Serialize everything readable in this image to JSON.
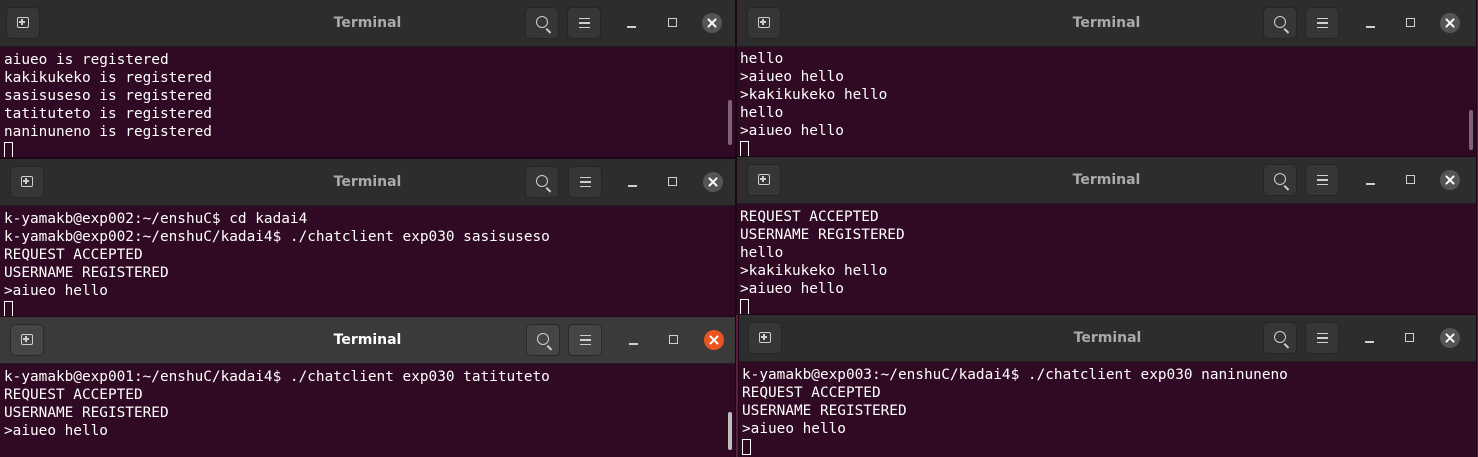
{
  "windows": [
    {
      "title": "Terminal",
      "active": false,
      "lines": [
        "aiueo is registered",
        "kakikukeko is registered",
        "sasisuseso is registered",
        "tatituteto is registered",
        "naninuneno is registered"
      ]
    },
    {
      "title": "Terminal",
      "active": false,
      "lines": [
        "hello",
        ">aiueo hello",
        ">kakikukeko hello",
        "hello",
        ">aiueo hello"
      ]
    },
    {
      "title": "Terminal",
      "active": false,
      "lines": [
        "k-yamakb@exp002:~/enshuC$ cd kadai4",
        "k-yamakb@exp002:~/enshuC/kadai4$ ./chatclient exp030 sasisuseso",
        "REQUEST ACCEPTED",
        "USERNAME REGISTERED",
        ">aiueo hello"
      ]
    },
    {
      "title": "Terminal",
      "active": false,
      "lines": [
        "REQUEST ACCEPTED",
        "USERNAME REGISTERED",
        "hello",
        ">kakikukeko hello",
        ">aiueo hello"
      ]
    },
    {
      "title": "Terminal",
      "active": true,
      "lines": [
        "k-yamakb@exp001:~/enshuC/kadai4$ ./chatclient exp030 tatituteto",
        "REQUEST ACCEPTED",
        "USERNAME REGISTERED",
        ">aiueo hello"
      ]
    },
    {
      "title": "Terminal",
      "active": false,
      "lines": [
        "k-yamakb@exp003:~/enshuC/kadai4$ ./chatclient exp030 naninuneno",
        "REQUEST ACCEPTED",
        "USERNAME REGISTERED",
        ">aiueo hello"
      ]
    }
  ],
  "icons": {
    "new_tab": "new-tab-icon",
    "search": "search-icon",
    "menu": "hamburger-menu-icon",
    "minimize": "minimize-icon",
    "maximize": "maximize-icon",
    "close": "close-icon"
  },
  "colors": {
    "terminal_bg": "#300a24",
    "titlebar_bg": "#2d2d2d",
    "active_titlebar_bg": "#3a3a3a",
    "active_close": "#e95420",
    "text": "#ffffff",
    "desktop_bg": "#5a1f3f"
  }
}
